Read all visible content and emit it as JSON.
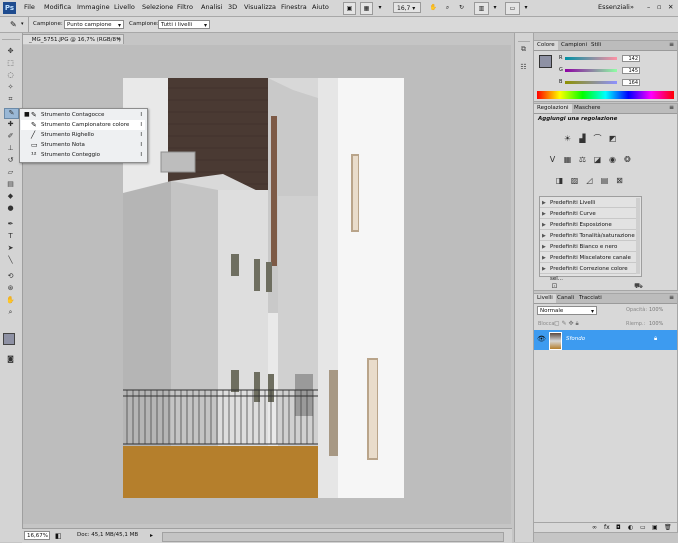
{
  "menubar": {
    "logo": "Ps",
    "items": [
      "File",
      "Modifica",
      "Immagine",
      "Livello",
      "Selezione",
      "Filtro",
      "Analisi",
      "3D",
      "Visualizza",
      "Finestra",
      "Aiuto"
    ],
    "zoom": "16,7",
    "workspace": "Essenziali"
  },
  "options": {
    "sample_label": "Campione:",
    "sample_value": "Punto campione",
    "sample2_label": "Campione:",
    "sample2_value": "Tutti i livelli"
  },
  "document": {
    "tab_title": "_MG_5751.JPG @ 16,7% (RGB/8*)",
    "zoom_field": "16,67%",
    "doc_info": "Doc: 45,1 MB/45,1 MB"
  },
  "flyout": {
    "items": [
      {
        "label": "Strumento Contagocce",
        "key": "I",
        "active": false
      },
      {
        "label": "Strumento Campionatore colore",
        "key": "I",
        "active": true
      },
      {
        "label": "Strumento Righello",
        "key": "I",
        "active": false
      },
      {
        "label": "Strumento Nota",
        "key": "I",
        "active": false
      },
      {
        "label": "Strumento Conteggio",
        "key": "I",
        "active": false
      }
    ]
  },
  "color_panel": {
    "tabs": [
      "Colore",
      "Campioni",
      "Stili"
    ],
    "channels": [
      {
        "label": "R",
        "value": "142"
      },
      {
        "label": "G",
        "value": "145"
      },
      {
        "label": "B",
        "value": "164"
      }
    ]
  },
  "adjust_panel": {
    "tabs": [
      "Regolazioni",
      "Maschere"
    ],
    "heading": "Aggiungi una regolazione",
    "presets": [
      "Predefiniti Livelli",
      "Predefiniti Curve",
      "Predefiniti Esposizione",
      "Predefiniti Tonalità/saturazione",
      "Predefiniti Bianco e nero",
      "Predefiniti Miscelatore canale",
      "Predefiniti Correzione colore sel..."
    ]
  },
  "layers_panel": {
    "tabs": [
      "Livelli",
      "Canali",
      "Tracciati"
    ],
    "blend_mode": "Normale",
    "opacity_label": "Opacità:",
    "opacity_value": "100%",
    "lock_label": "Blocca:",
    "fill_label": "Riemp.:",
    "fill_value": "100%",
    "layer_name": "Sfondo"
  },
  "colors": {
    "accent": "#3d9bf0",
    "logo_bg": "#1f4c8f",
    "ground": "#b57f2c"
  }
}
